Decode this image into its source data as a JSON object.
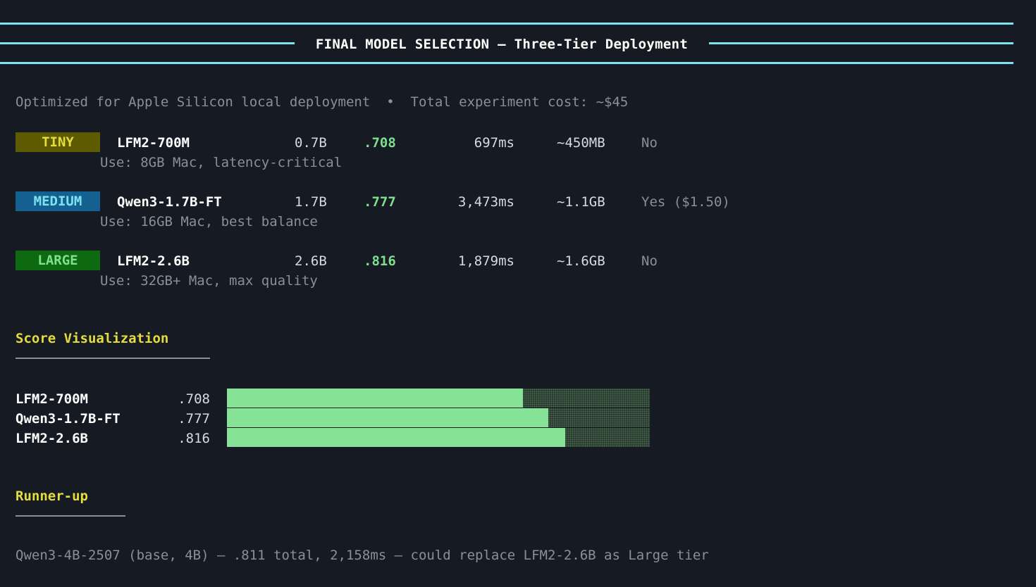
{
  "header": {
    "title": "FINAL MODEL SELECTION — Three-Tier Deployment"
  },
  "subtitle": "Optimized for Apple Silicon local deployment  •  Total experiment cost: ~$45",
  "tiers": [
    {
      "badge": "TINY",
      "badge_bg": "#5e5a00",
      "badge_fg": "#e4dd3d",
      "model": "LFM2-700M",
      "params": "0.7B",
      "score": ".708",
      "latency": "697ms",
      "memory": "~450MB",
      "finetuned": "No",
      "use": "Use: 8GB Mac, latency-critical"
    },
    {
      "badge": "MEDIUM",
      "badge_bg": "#146191",
      "badge_fg": "#7fe3ef",
      "model": "Qwen3-1.7B-FT",
      "params": "1.7B",
      "score": ".777",
      "latency": "3,473ms",
      "memory": "~1.1GB",
      "finetuned": "Yes ($1.50)",
      "use": "Use: 16GB Mac, best balance"
    },
    {
      "badge": "LARGE",
      "badge_bg": "#0e6a10",
      "badge_fg": "#7ee08e",
      "model": "LFM2-2.6B",
      "params": "2.6B",
      "score": ".816",
      "latency": "1,879ms",
      "memory": "~1.6GB",
      "finetuned": "No",
      "use": "Use: 32GB+ Mac, max quality"
    }
  ],
  "score_viz": {
    "title": "Score Visualization",
    "bars": [
      {
        "name": "LFM2-700M",
        "score_label": ".708",
        "fill_fraction": 0.7
      },
      {
        "name": "Qwen3-1.7B-FT",
        "score_label": ".777",
        "fill_fraction": 0.76
      },
      {
        "name": "LFM2-2.6B",
        "score_label": ".816",
        "fill_fraction": 0.8
      }
    ]
  },
  "runner_up": {
    "title": "Runner-up",
    "text": "Qwen3-4B-2507 (base, 4B) — .811 total, 2,158ms — could replace LFM2-2.6B as Large tier"
  },
  "colors": {
    "accent_cyan": "#7fe3ef",
    "accent_yellow": "#e4dd3d",
    "score_green": "#7ee08e",
    "bar_fill": "#86e296",
    "background": "#161a22"
  }
}
